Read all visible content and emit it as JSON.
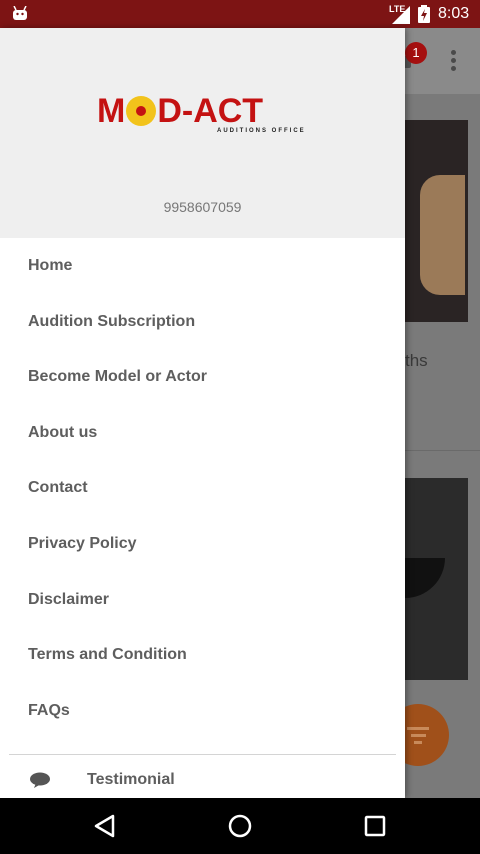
{
  "status_bar": {
    "time": "8:03",
    "network": "LTE"
  },
  "background": {
    "notification_count": "1",
    "partial_text": "ths"
  },
  "drawer": {
    "logo_text": "MOD-ACT",
    "logo_subtitle": "AUDITIONS OFFICE",
    "phone": "9958607059",
    "menu": [
      "Home",
      "Audition Subscription",
      "Become Model or Actor",
      "About us",
      "Contact",
      "Privacy Policy",
      "Disclaimer",
      "Terms and Condition",
      "FAQs"
    ],
    "testimonial_label": "Testimonial"
  },
  "colors": {
    "status_bar": "#7d1414",
    "brand_red": "#c41212",
    "brand_yellow": "#f2c31b",
    "menu_text": "#5e5e5e"
  },
  "icons": {
    "status": [
      "android-icon",
      "signal-icon",
      "battery-icon"
    ],
    "nav": [
      "back-icon",
      "home-icon",
      "recents-icon"
    ],
    "testimonial": "chat-bubble-icon"
  }
}
